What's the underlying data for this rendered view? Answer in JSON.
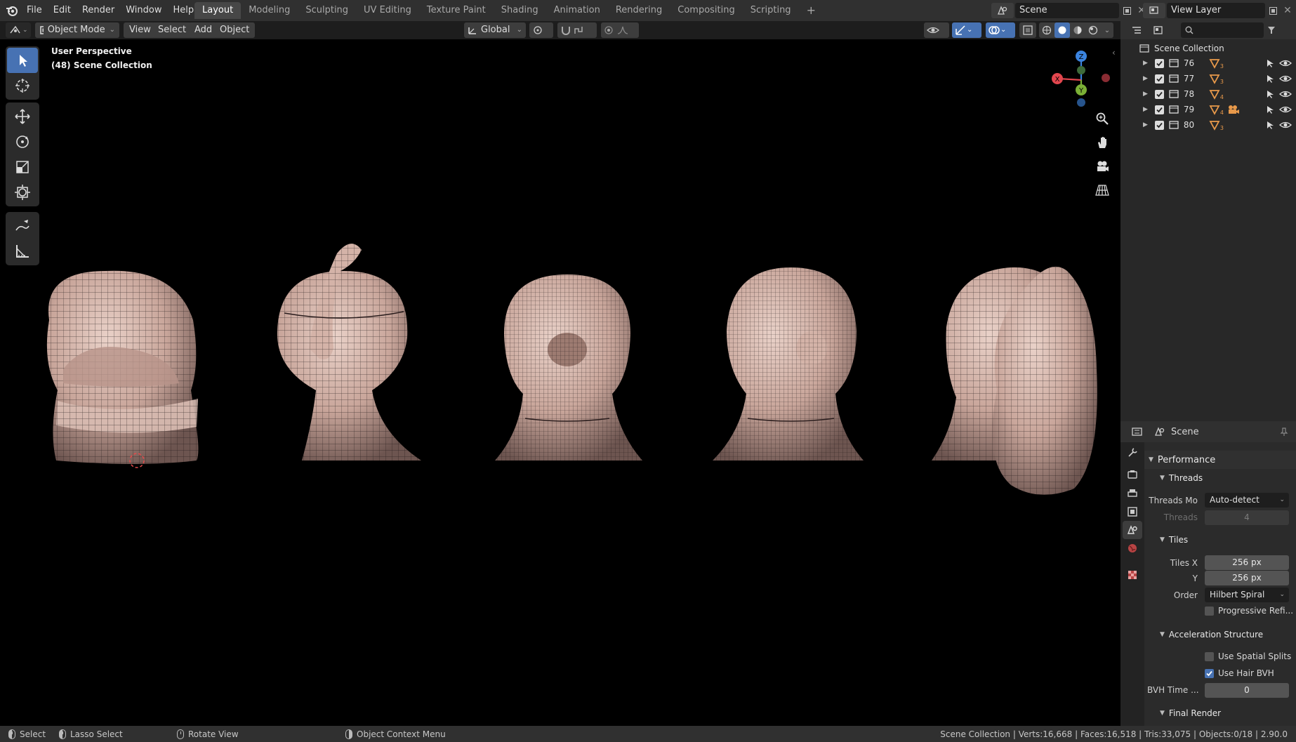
{
  "topbar": {
    "menus": [
      "File",
      "Edit",
      "Render",
      "Window",
      "Help"
    ],
    "workspaces": [
      "Layout",
      "Modeling",
      "Sculpting",
      "UV Editing",
      "Texture Paint",
      "Shading",
      "Animation",
      "Rendering",
      "Compositing",
      "Scripting"
    ],
    "active_workspace": "Layout",
    "add_tab_label": "+",
    "scene_name": "Scene",
    "view_layer_name": "View Layer"
  },
  "viewport_header": {
    "mode": "Object Mode",
    "menus": [
      "View",
      "Select",
      "Add",
      "Object"
    ],
    "transform_orientation": "Global"
  },
  "viewport": {
    "overlay_title": "User Perspective",
    "overlay_subtitle": "(48) Scene Collection",
    "gizmo_axes": {
      "x": "X",
      "y": "Y",
      "z": "Z"
    },
    "colors": {
      "x": "#e2464e",
      "y": "#7bb036",
      "z": "#3b84df"
    }
  },
  "toolbar": {
    "tools": [
      "select-box",
      "cursor",
      "move",
      "rotate",
      "scale",
      "transform",
      "annotate",
      "measure"
    ],
    "active_tool": "select-box"
  },
  "outliner": {
    "search_placeholder": "",
    "root": "Scene Collection",
    "collections": [
      {
        "name": "76",
        "mesh_count": "3"
      },
      {
        "name": "77",
        "mesh_count": "3"
      },
      {
        "name": "78",
        "mesh_count": "4"
      },
      {
        "name": "79",
        "mesh_count": "4"
      },
      {
        "name": "80",
        "mesh_count": "3"
      }
    ]
  },
  "properties": {
    "context": "Scene",
    "sections": {
      "performance": "Performance",
      "threads": "Threads",
      "tiles": "Tiles",
      "accel": "Acceleration Structure",
      "final_render": "Final Render"
    },
    "threads_mode_label": "Threads Mo",
    "threads_mode_value": "Auto-detect",
    "threads_label": "Threads",
    "threads_value": "4",
    "tiles_x_label": "Tiles X",
    "tiles_x_value": "256 px",
    "tiles_y_label": "Y",
    "tiles_y_value": "256 px",
    "order_label": "Order",
    "order_value": "Hilbert Spiral",
    "progressive_label": "Progressive Refi...",
    "progressive_checked": false,
    "spatial_splits_label": "Use Spatial Splits",
    "spatial_splits_checked": false,
    "hair_bvh_label": "Use Hair BVH",
    "hair_bvh_checked": true,
    "bvh_time_label": "BVH Time ...",
    "bvh_time_value": "0"
  },
  "statusbar": {
    "select": "Select",
    "lasso": "Lasso Select",
    "rotate": "Rotate View",
    "context_menu": "Object Context Menu",
    "stats": "Scene Collection | Verts:16,668 | Faces:16,518 | Tris:33,075 | Objects:0/18 | 2.90.0"
  }
}
